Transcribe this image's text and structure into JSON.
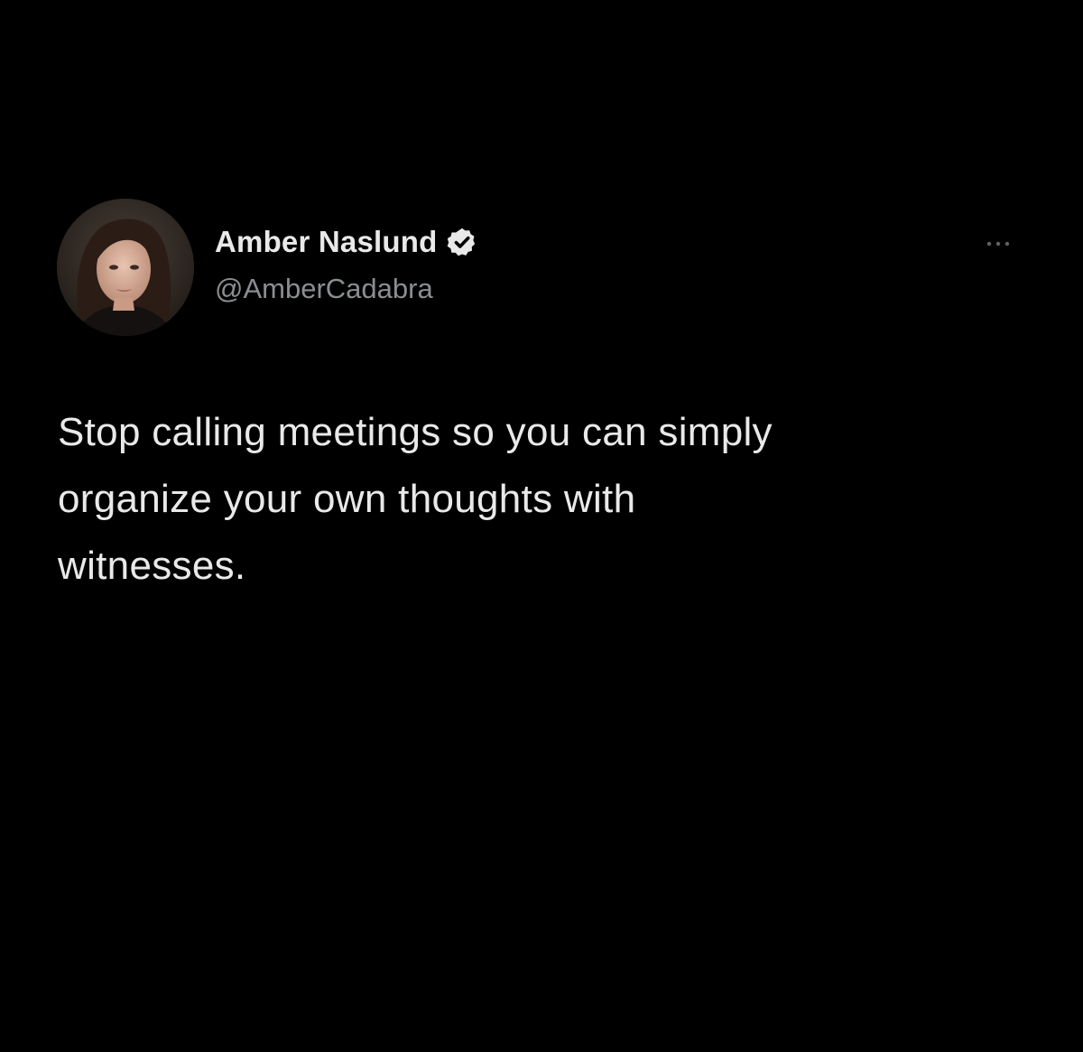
{
  "author": {
    "display_name": "Amber Naslund",
    "handle": "@AmberCadabra",
    "verified": true,
    "avatar_icon": "profile-photo",
    "verified_icon": "verified-badge-icon"
  },
  "tweet": {
    "text": "Stop calling meetings so you can simply\norganize your own thoughts with\nwitnesses."
  },
  "more_icon": "more-options-icon",
  "colors": {
    "background": "#000000",
    "primary_text": "#e9e9e9",
    "secondary_text": "#8b8e91",
    "badge": "#e9e9e9"
  }
}
